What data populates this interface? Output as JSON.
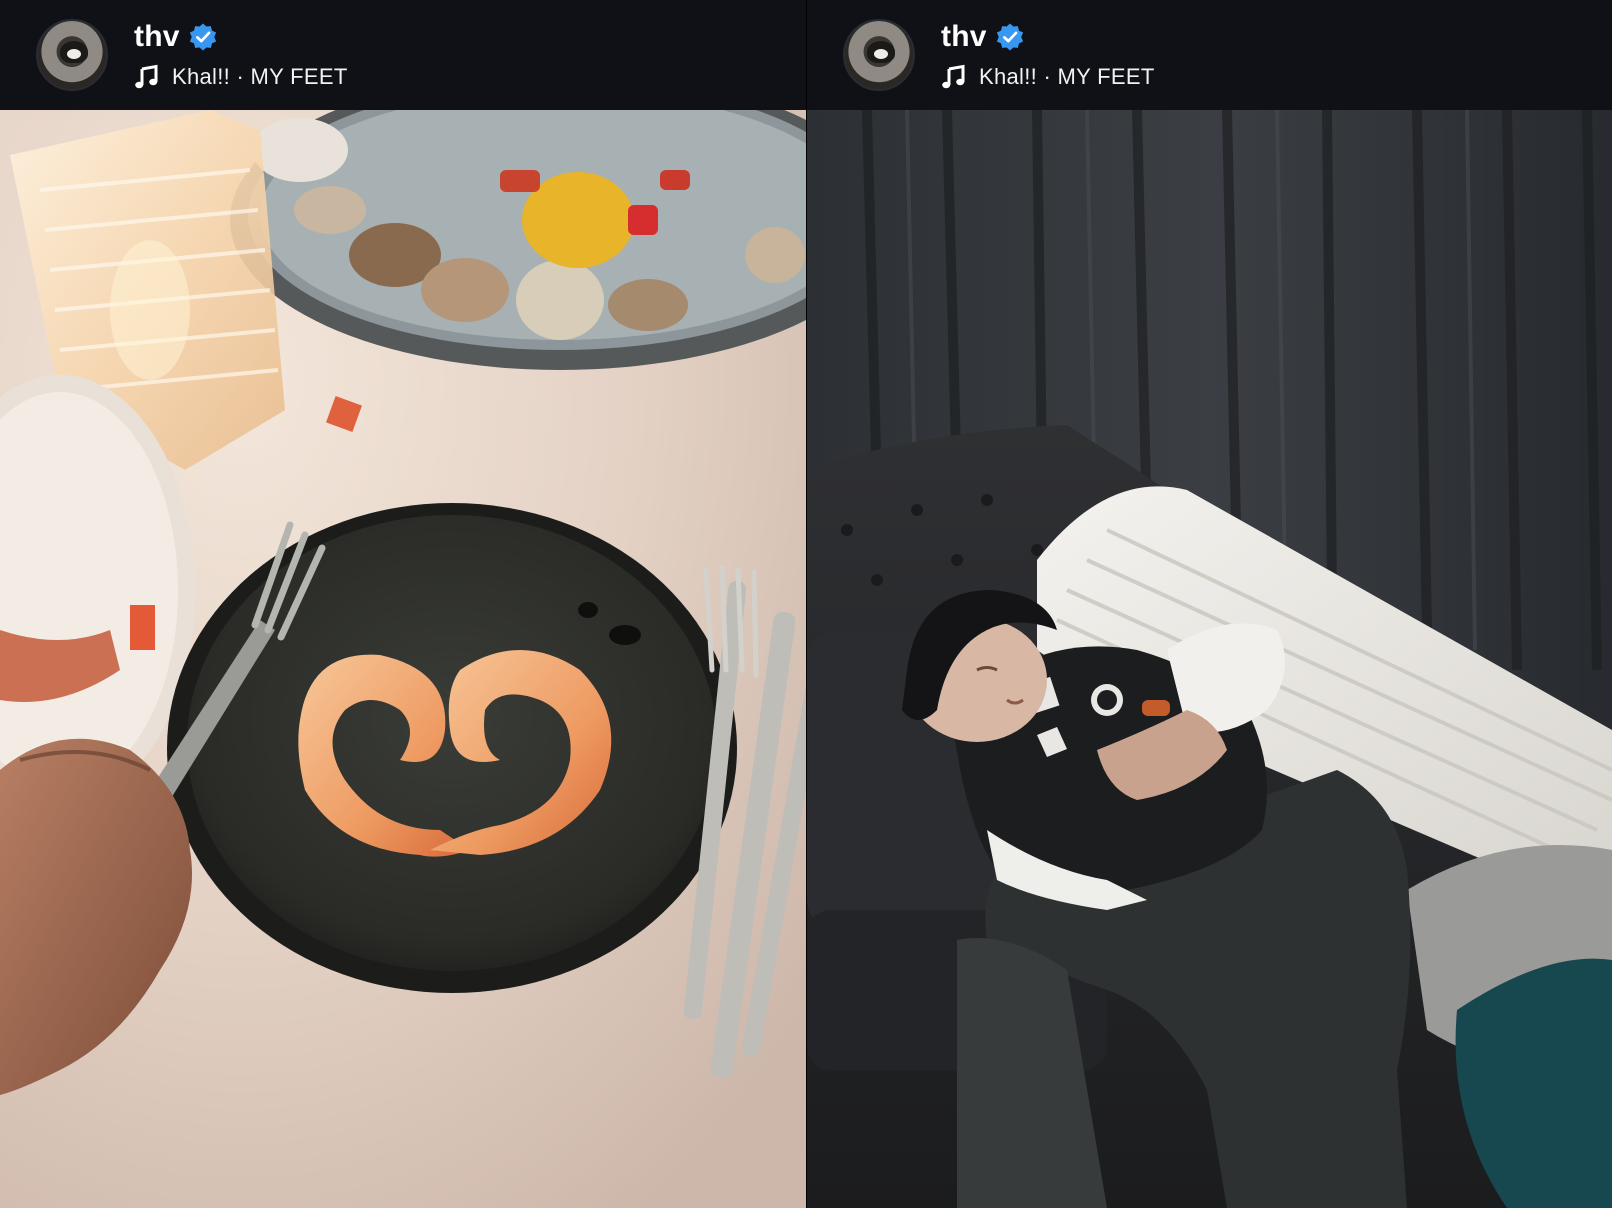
{
  "stories": [
    {
      "username": "thv",
      "verified": true,
      "music": {
        "artist": "Khal!!",
        "separator": "·",
        "title": "MY FEET"
      },
      "photo_alt": "Dinner table with two shrimp on a dark plate"
    },
    {
      "username": "thv",
      "verified": true,
      "music": {
        "artist": "Khal!!",
        "separator": "·",
        "title": "MY FEET"
      },
      "photo_alt": "Person sleeping on a black leather sofa"
    }
  ],
  "colors": {
    "header_bg": "#0f1116",
    "verified_blue": "#3897f0",
    "text": "#ffffff"
  }
}
